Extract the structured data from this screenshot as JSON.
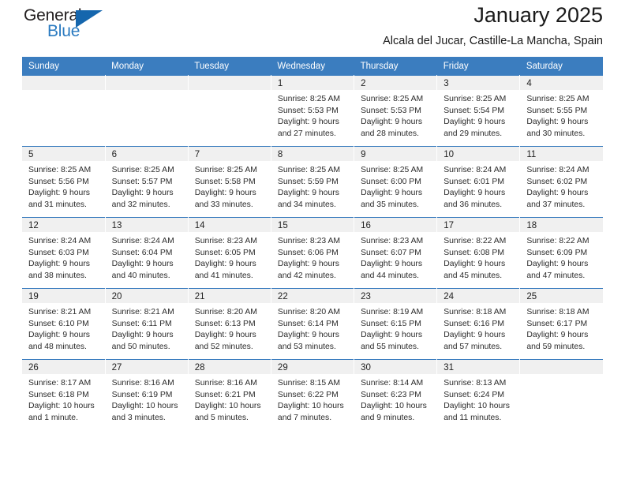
{
  "brand": {
    "name_part1": "General",
    "name_part2": "Blue",
    "triangle_color": "#1566ad",
    "blue_color": "#2a7ac0"
  },
  "header": {
    "title": "January 2025",
    "subtitle": "Alcala del Jucar, Castille-La Mancha, Spain"
  },
  "theme": {
    "header_row_color": "#3b7dbf",
    "daynum_band_color": "#f0f0f0",
    "cell_background": "#ffffff"
  },
  "weekday_headers": [
    "Sunday",
    "Monday",
    "Tuesday",
    "Wednesday",
    "Thursday",
    "Friday",
    "Saturday"
  ],
  "weeks": [
    [
      {
        "day": "",
        "lines": []
      },
      {
        "day": "",
        "lines": []
      },
      {
        "day": "",
        "lines": []
      },
      {
        "day": "1",
        "lines": [
          "Sunrise: 8:25 AM",
          "Sunset: 5:53 PM",
          "Daylight: 9 hours",
          "and 27 minutes."
        ]
      },
      {
        "day": "2",
        "lines": [
          "Sunrise: 8:25 AM",
          "Sunset: 5:53 PM",
          "Daylight: 9 hours",
          "and 28 minutes."
        ]
      },
      {
        "day": "3",
        "lines": [
          "Sunrise: 8:25 AM",
          "Sunset: 5:54 PM",
          "Daylight: 9 hours",
          "and 29 minutes."
        ]
      },
      {
        "day": "4",
        "lines": [
          "Sunrise: 8:25 AM",
          "Sunset: 5:55 PM",
          "Daylight: 9 hours",
          "and 30 minutes."
        ]
      }
    ],
    [
      {
        "day": "5",
        "lines": [
          "Sunrise: 8:25 AM",
          "Sunset: 5:56 PM",
          "Daylight: 9 hours",
          "and 31 minutes."
        ]
      },
      {
        "day": "6",
        "lines": [
          "Sunrise: 8:25 AM",
          "Sunset: 5:57 PM",
          "Daylight: 9 hours",
          "and 32 minutes."
        ]
      },
      {
        "day": "7",
        "lines": [
          "Sunrise: 8:25 AM",
          "Sunset: 5:58 PM",
          "Daylight: 9 hours",
          "and 33 minutes."
        ]
      },
      {
        "day": "8",
        "lines": [
          "Sunrise: 8:25 AM",
          "Sunset: 5:59 PM",
          "Daylight: 9 hours",
          "and 34 minutes."
        ]
      },
      {
        "day": "9",
        "lines": [
          "Sunrise: 8:25 AM",
          "Sunset: 6:00 PM",
          "Daylight: 9 hours",
          "and 35 minutes."
        ]
      },
      {
        "day": "10",
        "lines": [
          "Sunrise: 8:24 AM",
          "Sunset: 6:01 PM",
          "Daylight: 9 hours",
          "and 36 minutes."
        ]
      },
      {
        "day": "11",
        "lines": [
          "Sunrise: 8:24 AM",
          "Sunset: 6:02 PM",
          "Daylight: 9 hours",
          "and 37 minutes."
        ]
      }
    ],
    [
      {
        "day": "12",
        "lines": [
          "Sunrise: 8:24 AM",
          "Sunset: 6:03 PM",
          "Daylight: 9 hours",
          "and 38 minutes."
        ]
      },
      {
        "day": "13",
        "lines": [
          "Sunrise: 8:24 AM",
          "Sunset: 6:04 PM",
          "Daylight: 9 hours",
          "and 40 minutes."
        ]
      },
      {
        "day": "14",
        "lines": [
          "Sunrise: 8:23 AM",
          "Sunset: 6:05 PM",
          "Daylight: 9 hours",
          "and 41 minutes."
        ]
      },
      {
        "day": "15",
        "lines": [
          "Sunrise: 8:23 AM",
          "Sunset: 6:06 PM",
          "Daylight: 9 hours",
          "and 42 minutes."
        ]
      },
      {
        "day": "16",
        "lines": [
          "Sunrise: 8:23 AM",
          "Sunset: 6:07 PM",
          "Daylight: 9 hours",
          "and 44 minutes."
        ]
      },
      {
        "day": "17",
        "lines": [
          "Sunrise: 8:22 AM",
          "Sunset: 6:08 PM",
          "Daylight: 9 hours",
          "and 45 minutes."
        ]
      },
      {
        "day": "18",
        "lines": [
          "Sunrise: 8:22 AM",
          "Sunset: 6:09 PM",
          "Daylight: 9 hours",
          "and 47 minutes."
        ]
      }
    ],
    [
      {
        "day": "19",
        "lines": [
          "Sunrise: 8:21 AM",
          "Sunset: 6:10 PM",
          "Daylight: 9 hours",
          "and 48 minutes."
        ]
      },
      {
        "day": "20",
        "lines": [
          "Sunrise: 8:21 AM",
          "Sunset: 6:11 PM",
          "Daylight: 9 hours",
          "and 50 minutes."
        ]
      },
      {
        "day": "21",
        "lines": [
          "Sunrise: 8:20 AM",
          "Sunset: 6:13 PM",
          "Daylight: 9 hours",
          "and 52 minutes."
        ]
      },
      {
        "day": "22",
        "lines": [
          "Sunrise: 8:20 AM",
          "Sunset: 6:14 PM",
          "Daylight: 9 hours",
          "and 53 minutes."
        ]
      },
      {
        "day": "23",
        "lines": [
          "Sunrise: 8:19 AM",
          "Sunset: 6:15 PM",
          "Daylight: 9 hours",
          "and 55 minutes."
        ]
      },
      {
        "day": "24",
        "lines": [
          "Sunrise: 8:18 AM",
          "Sunset: 6:16 PM",
          "Daylight: 9 hours",
          "and 57 minutes."
        ]
      },
      {
        "day": "25",
        "lines": [
          "Sunrise: 8:18 AM",
          "Sunset: 6:17 PM",
          "Daylight: 9 hours",
          "and 59 minutes."
        ]
      }
    ],
    [
      {
        "day": "26",
        "lines": [
          "Sunrise: 8:17 AM",
          "Sunset: 6:18 PM",
          "Daylight: 10 hours",
          "and 1 minute."
        ]
      },
      {
        "day": "27",
        "lines": [
          "Sunrise: 8:16 AM",
          "Sunset: 6:19 PM",
          "Daylight: 10 hours",
          "and 3 minutes."
        ]
      },
      {
        "day": "28",
        "lines": [
          "Sunrise: 8:16 AM",
          "Sunset: 6:21 PM",
          "Daylight: 10 hours",
          "and 5 minutes."
        ]
      },
      {
        "day": "29",
        "lines": [
          "Sunrise: 8:15 AM",
          "Sunset: 6:22 PM",
          "Daylight: 10 hours",
          "and 7 minutes."
        ]
      },
      {
        "day": "30",
        "lines": [
          "Sunrise: 8:14 AM",
          "Sunset: 6:23 PM",
          "Daylight: 10 hours",
          "and 9 minutes."
        ]
      },
      {
        "day": "31",
        "lines": [
          "Sunrise: 8:13 AM",
          "Sunset: 6:24 PM",
          "Daylight: 10 hours",
          "and 11 minutes."
        ]
      },
      {
        "day": "",
        "lines": []
      }
    ]
  ]
}
